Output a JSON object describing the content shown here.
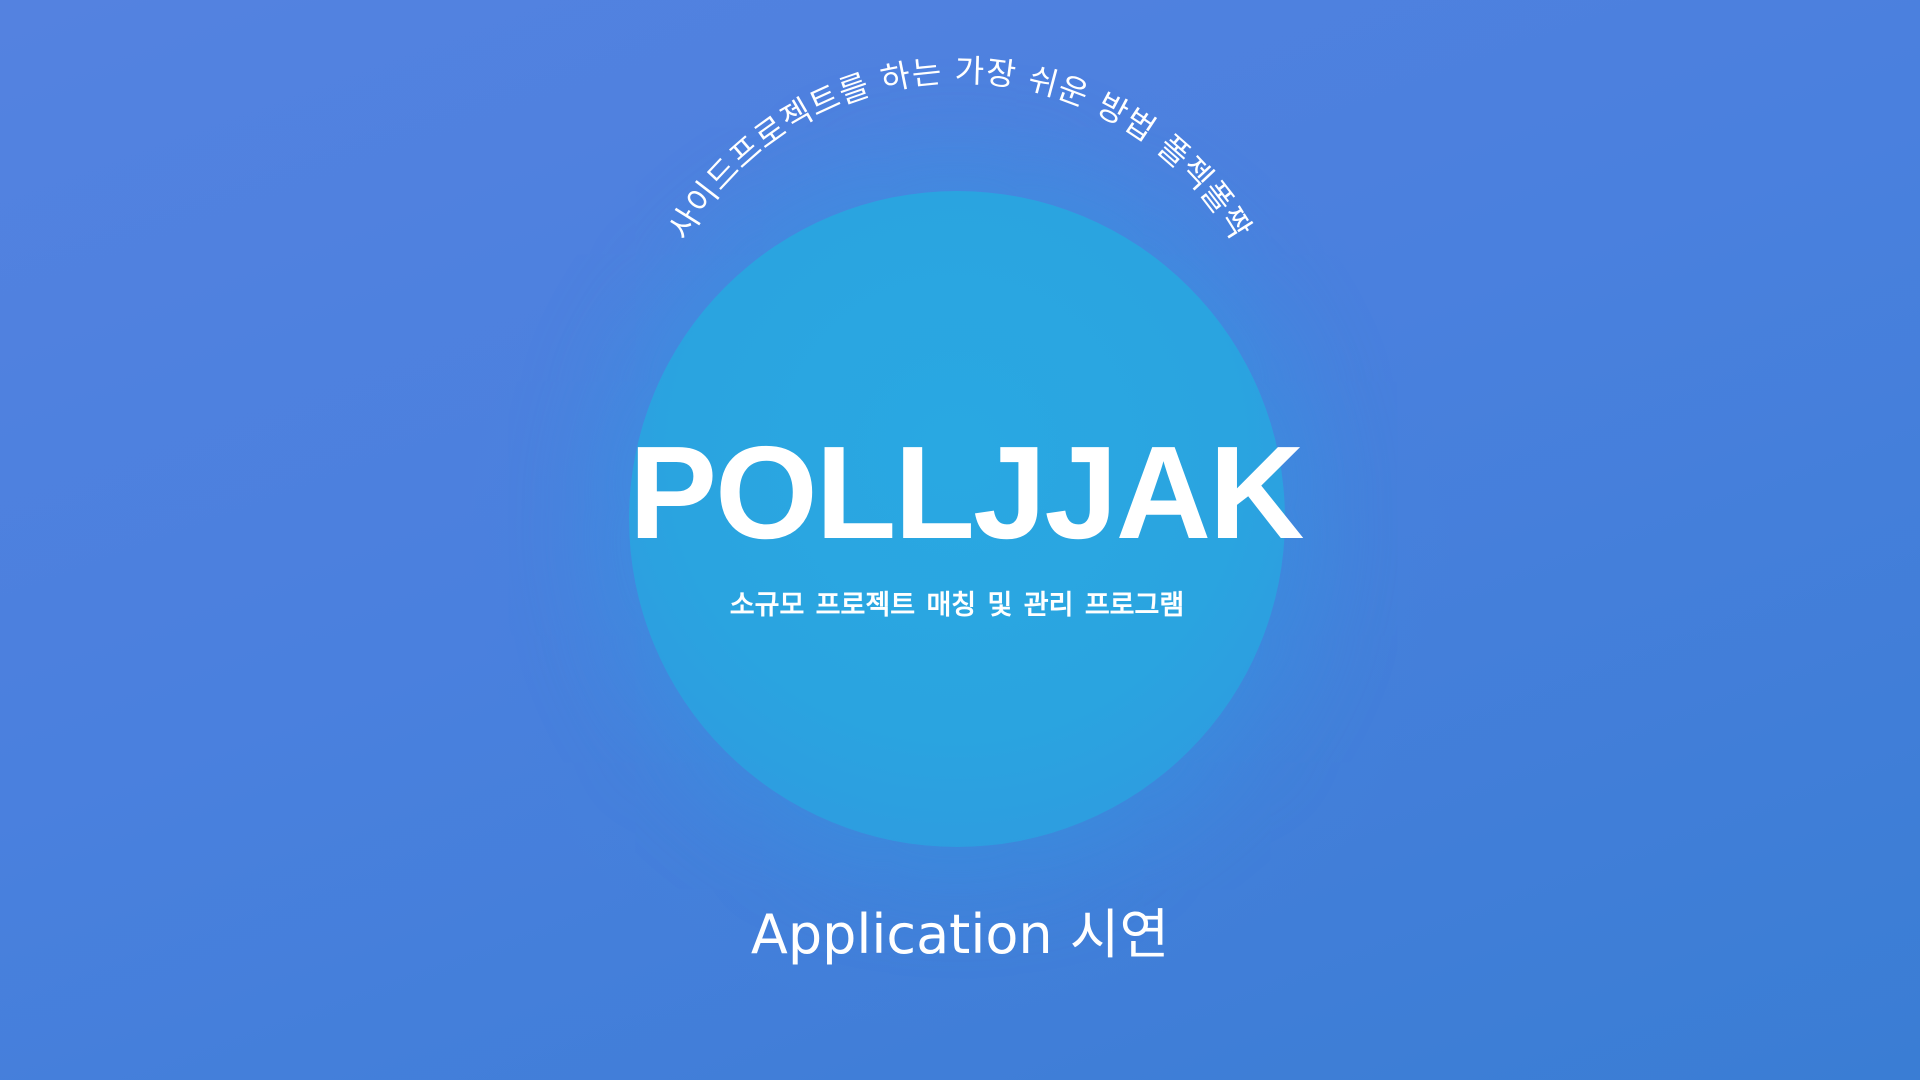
{
  "slide": {
    "tagline": "사이드프로젝트를 하는 가장 쉬운 방법 폴젝폴짝",
    "title": "POLLJJAK",
    "subtitle": "소규모 프로젝트  매칭 및 관리 프로그램",
    "demo_label": "Application 시연"
  },
  "colors": {
    "background": "#4c81dd",
    "circle": "#2aa4e0",
    "text": "#ffffff"
  }
}
